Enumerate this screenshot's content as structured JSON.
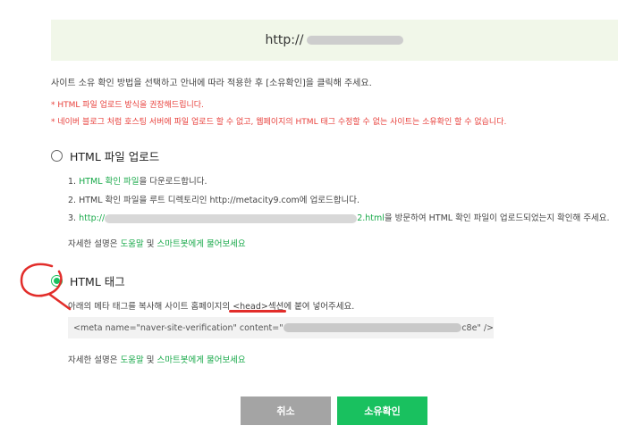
{
  "site": {
    "url_prefix": "http://"
  },
  "intro": "사이트 소유 확인 방법을 선택하고 안내에 따라 적용한 후 [소유확인]을 클릭해 주세요.",
  "warnings": [
    "* HTML 파일 업로드 방식을 권장해드립니다.",
    "* 네이버 블로그 처럼 호스팅 서버에 파일 업로드 할 수 없고, 웹페이지의 HTML 태그 수정할 수 없는 사이트는 소유확인 할 수 없습니다."
  ],
  "option_file": {
    "label": "HTML 파일 업로드",
    "selected": false,
    "step1_link": "HTML 확인 파일",
    "step1_rest": "을 다운로드합니다.",
    "step2": "2. HTML 확인 파일을 루트 디렉토리인 http://metacity9.com에 업로드합니다.",
    "step3_link_start": "http://",
    "step3_link_end": "2.html",
    "step3_rest": "을 방문하여 HTML 확인 파일이 업로드되었는지 확인해 주세요."
  },
  "option_tag": {
    "label": "HTML 태그",
    "selected": true,
    "description_a": "아래의 메타 태그를 복사해 사이트 홈페이지의 ",
    "description_b": "<head>섹션",
    "description_c": "에 붙여 넣어주세요.",
    "code_prefix": "<meta name=\"naver-site-verification\" content=\"",
    "code_suffix": "c8e\" />"
  },
  "help": {
    "prefix": "자세한 설명은 ",
    "link_help": "도움말",
    "middle": " 및 ",
    "link_bot": "스마트봇에게 물어보세요"
  },
  "buttons": {
    "cancel": "취소",
    "confirm": "소유확인"
  },
  "colors": {
    "accent_green": "#19c15f",
    "warning_red": "#e8413c",
    "annotation_red": "#e22d2a"
  }
}
